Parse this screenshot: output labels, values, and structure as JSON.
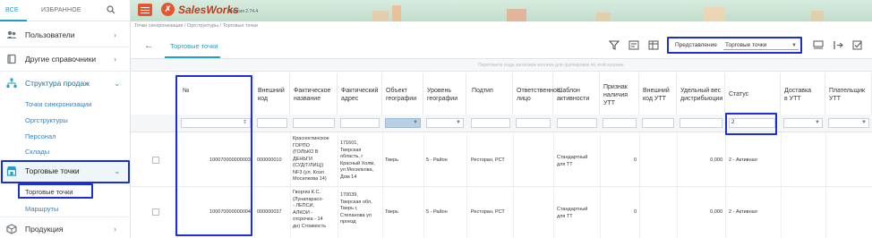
{
  "sidebar": {
    "tab_all": "ВСЕ",
    "tab_favorites": "ИЗБРАННОЕ",
    "items": {
      "users": "Пользователи",
      "other_refs": "Другие справочники",
      "sales_structure": "Структура продаж",
      "sync_points": "Точки синхронизации",
      "org_structures": "Оргструктуры",
      "personnel": "Персонал",
      "warehouses": "Склады",
      "trade_points": "Торговые точки",
      "trade_points_sub": "Торговые точки",
      "routes": "Маршруты",
      "products": "Продукция"
    }
  },
  "header": {
    "logo_text": "SalesWorks",
    "version": "Версия 2.74.4"
  },
  "breadcrumb": "Точки синхронизации / Оргструктуры / Торговые точки",
  "tab": {
    "label": "Торговые точки"
  },
  "view": {
    "label": "Представление",
    "value": "Торговые точки"
  },
  "grid": {
    "group_hint": "Перетяните сюда заголовок колонки для группировки по этой колонке",
    "columns": [
      "№",
      "Внешний\nкод",
      "Фактическое\nназвание",
      "Фактический\nадрес",
      "Объект\nгеографии",
      "Уровень\nгеографии",
      "Подтип",
      "Ответственное\nлицо",
      "Шаблон\nактивности",
      "Признак\nналичия\nУТТ",
      "Внешний\nкод УТТ",
      "Удельный вес\nдистрибьюции",
      "Статус",
      "Доставка\nв УТТ",
      "Плательщик\nУТТ"
    ],
    "status_filter": "2",
    "rows": [
      {
        "num": "100070000000003",
        "ext_code": "000000010",
        "name": "Красноглинское\nГОРПО\n(ГОЛЬКО В\nДЕНЬГИ\n(СУД/Т/ЛИЦ))\nNF3 (ул. Коэл\nМосилкова 14)",
        "address": "171601,\nТверская\nобласть, г\nКрасный Холм,\nул Мосилкова,\nДом 14",
        "geo_obj": "Тверь",
        "geo_level": "5 - Район",
        "subtype": "Ресторан, РСТ",
        "template": "Стандартный\nдля ТТ",
        "has_utt": "0",
        "weight": "0,000",
        "status": "2 - Активная"
      },
      {
        "num": "100070000000004",
        "ext_code": "000000037",
        "name": "Гворгиз К.С.\n(Лунапарасо-\n- ЛЕПСИ,\nАЛКОИ -\nотсрочка - 14\nдн) Стоимость",
        "address": "170039,\nТверская обл,\nТверь г,\nСтепанова ул\nпроезд",
        "geo_obj": "Тверь",
        "geo_level": "5 - Район",
        "subtype": "Ресторан, РСТ",
        "template": "Стандартный\nдля ТТ",
        "has_utt": "0",
        "weight": "0,000",
        "status": "2 - Активная"
      }
    ]
  },
  "colors": {
    "accent": "#1ea0c8",
    "brand": "#e8542d",
    "highlight_box": "#1a2fd6"
  }
}
